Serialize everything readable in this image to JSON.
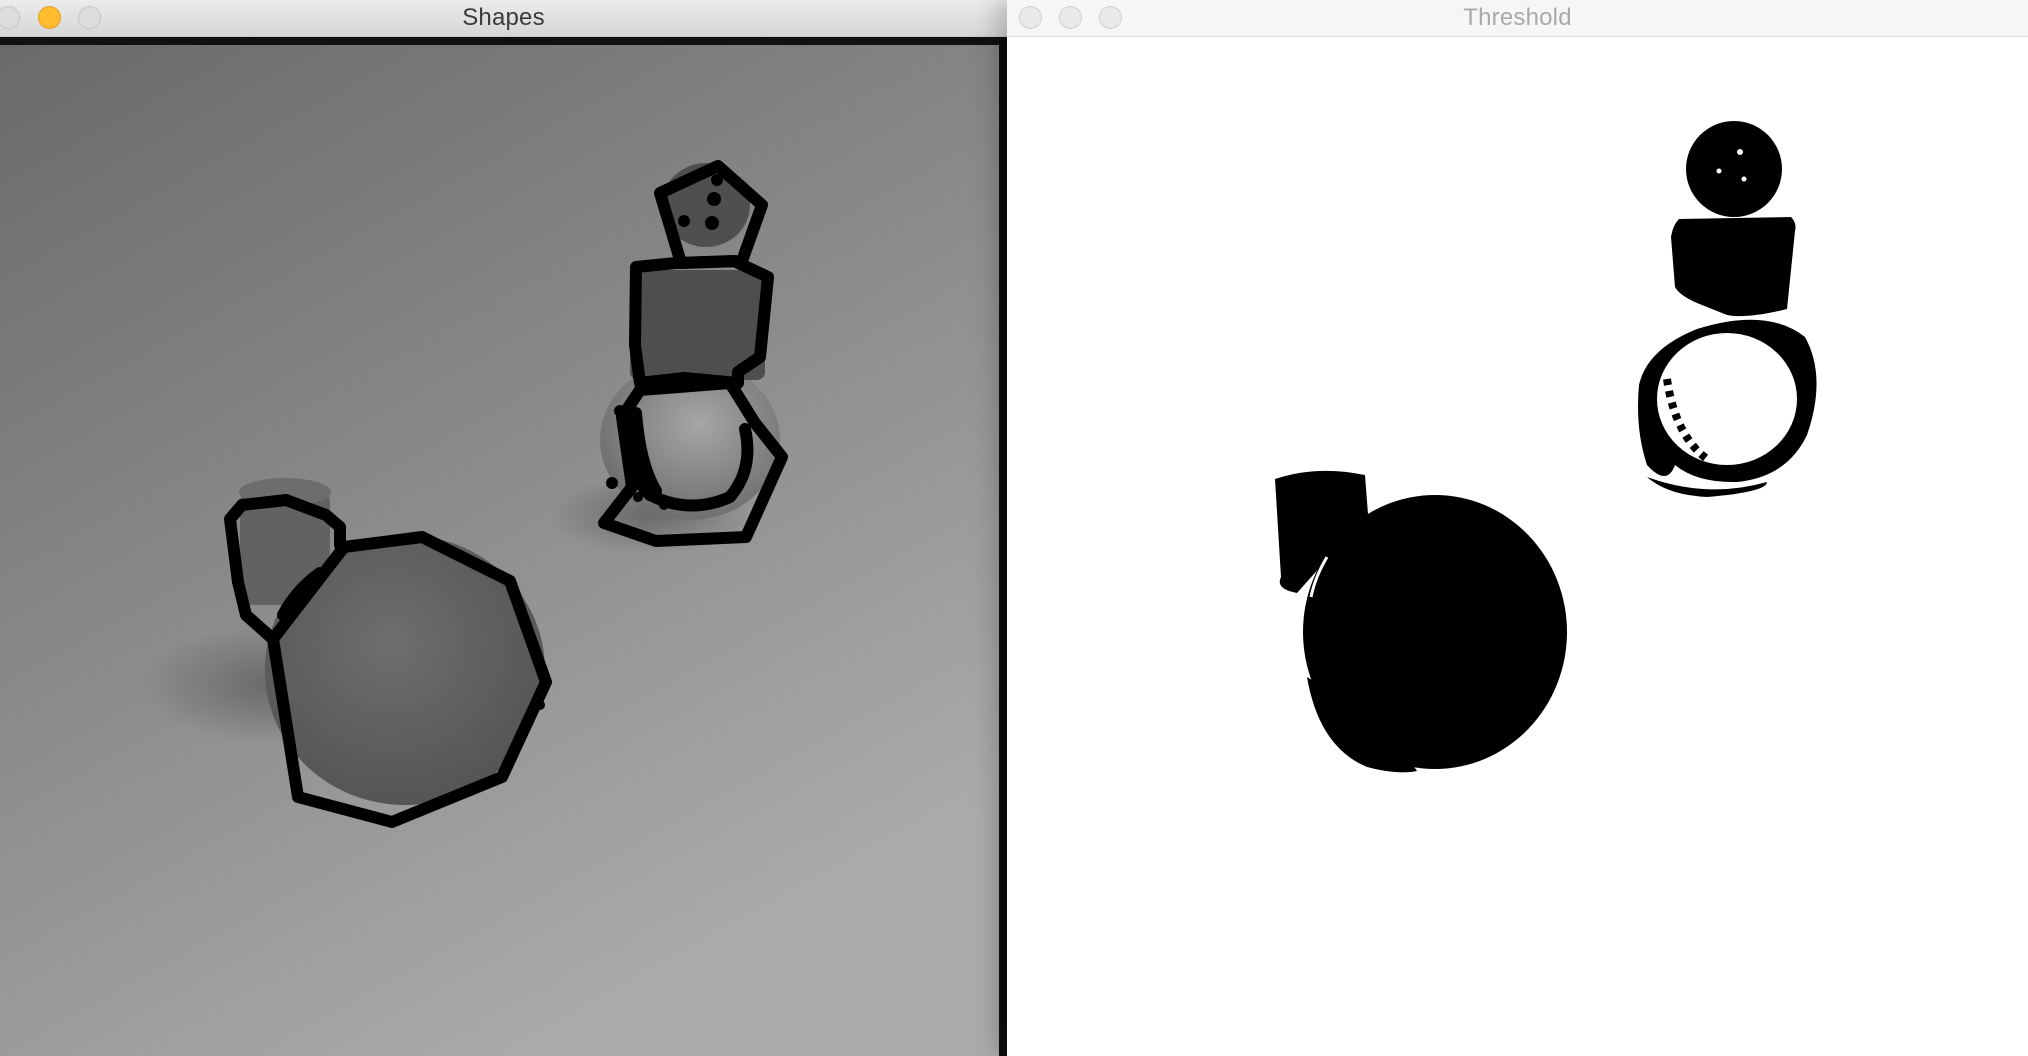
{
  "windows": {
    "shapes": {
      "title": "Shapes"
    },
    "threshold": {
      "title": "Threshold"
    }
  },
  "icons": {
    "close": "close-button-icon",
    "minimize": "minimize-button-icon",
    "zoom": "zoom-button-icon"
  },
  "colors": {
    "background_image_dark": "#6c6c6c",
    "background_image_light": "#a8a8a8",
    "contour_stroke": "#000000",
    "threshold_foreground": "#000000",
    "threshold_background": "#ffffff",
    "minimize_light": "#febc2e"
  }
}
